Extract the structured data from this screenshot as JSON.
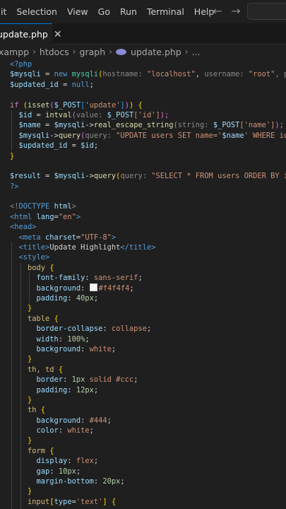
{
  "menu": [
    "it",
    "Selection",
    "View",
    "Go",
    "Run",
    "Terminal",
    "Help"
  ],
  "nav": {
    "back": "←",
    "forward": "→"
  },
  "tab": {
    "label": "update.php",
    "close": "✕"
  },
  "breadcrumb": [
    "xampp",
    "htdocs",
    "graph",
    "update.php",
    "..."
  ],
  "code": {
    "l1": "<?php",
    "l2a": "$mysqli",
    "l2b": " = ",
    "l2c": "new ",
    "l2d": "mysqli",
    "l2e": "(",
    "l2f": "hostname: ",
    "l2g": "\"localhost\"",
    "l2h": ", ",
    "l2i": "username: ",
    "l2j": "\"root\"",
    "l2k": ", pass",
    "l3a": "$updated_id",
    "l3b": " = ",
    "l3c": "null",
    "l3d": ";",
    "l5a": "if ",
    "l5b": "(",
    "l5c": "isset",
    "l5d": "(",
    "l5e": "$_POST",
    "l5f": "[",
    "l5g": "'update'",
    "l5h": "]",
    "l5i": ")",
    "l5j": ")",
    "l5k": " {",
    "l6a": "  $id",
    "l6b": " = ",
    "l6c": "intval",
    "l6d": "(",
    "l6e": "value: ",
    "l6f": "$_POST",
    "l6g": "['id']",
    "l6h": ");",
    "l7a": "  $name",
    "l7b": " = ",
    "l7c": "$mysqli",
    "l7d": "->",
    "l7e": "real_escape_string",
    "l7f": "(",
    "l7g": "string: ",
    "l7h": "$_POST",
    "l7i": "['name']",
    "l7j": ");",
    "l8a": "  $mysqli",
    "l8b": "->",
    "l8c": "query",
    "l8d": "(",
    "l8e": "query: ",
    "l8f": "\"UPDATE users SET name='",
    "l8g": "$name",
    "l8h": "' WHERE id=$",
    "l9a": "  $updated_id",
    "l9b": " = ",
    "l9c": "$id",
    "l9d": ";",
    "l10": "}",
    "l12a": "$result",
    "l12b": " = ",
    "l12c": "$mysqli",
    "l12d": "->",
    "l12e": "query",
    "l12f": "(",
    "l12g": "query: ",
    "l12h": "\"SELECT * FROM users ORDER BY id A",
    "l13": "?>",
    "l15a": "<!",
    "l15b": "DOCTYPE",
    "l15c": " html",
    "l15d": ">",
    "l16a": "<html ",
    "l16b": "lang",
    "l16c": "=",
    "l16d": "\"en\"",
    "l16e": ">",
    "l17": "<head>",
    "l18a": "  <meta ",
    "l18b": "charset",
    "l18c": "=",
    "l18d": "\"UTF-8\"",
    "l18e": ">",
    "l19a": "  <title>",
    "l19b": "Update Highlight",
    "l19c": "</title>",
    "l20": "  <style>",
    "l21a": "    body",
    "l21b": " {",
    "l22a": "      font-family",
    "l22b": ": ",
    "l22c": "sans-serif",
    "l22d": ";",
    "l23a": "      background",
    "l23b": ": ",
    "l23c": "#f4f4f4",
    "l23d": ";",
    "l24a": "      padding",
    "l24b": ": ",
    "l24c": "40px",
    "l24d": ";",
    "l25": "    }",
    "l26a": "    table",
    "l26b": " {",
    "l27a": "      border-collapse",
    "l27b": ": ",
    "l27c": "collapse",
    "l27d": ";",
    "l28a": "      width",
    "l28b": ": ",
    "l28c": "100%",
    "l28d": ";",
    "l29a": "      background",
    "l29b": ": ",
    "l29c": "white",
    "l29d": ";",
    "l30": "    }",
    "l31a": "    th, td",
    "l31b": " {",
    "l32a": "      border",
    "l32b": ": ",
    "l32c": "1px",
    "l32d": " solid #ccc",
    ";": ";",
    "l32e": ";",
    "l33a": "      padding",
    "l33b": ": ",
    "l33c": "12px",
    "l33d": ";",
    "l34": "    }",
    "l35a": "    th",
    "l35b": " {",
    "l36a": "      background",
    "l36b": ": ",
    "l36c": "#444",
    "l36d": ";",
    "l37a": "      color",
    "l37b": ": ",
    "l37c": "white",
    "l37d": ";",
    "l38": "    }",
    "l39a": "    form",
    "l39b": " {",
    "l40a": "      display",
    "l40b": ": ",
    "l40c": "flex",
    "l40d": ";",
    "l41a": "      gap",
    "l41b": ": ",
    "l41c": "10px",
    "l41d": ";",
    "l42a": "      margin-bottom",
    "l42b": ": ",
    "l42c": "20px",
    "l42d": ";",
    "l43": "    }",
    "l44a": "    input",
    "l44b": "[",
    "l44c": "type",
    "l44d": "=",
    "l44e": "'text'",
    "l44f": "]",
    "l44g": " {"
  }
}
